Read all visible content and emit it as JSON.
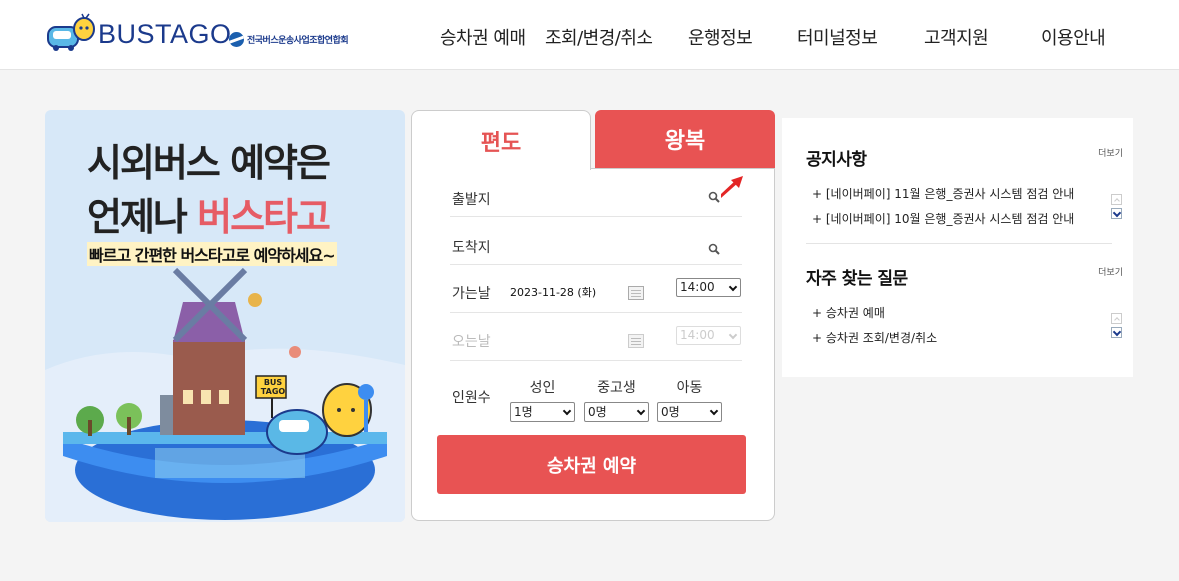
{
  "header": {
    "logo_text": "BUSTAGO",
    "association_text": "전국버스운송사업조합연합회",
    "nav": [
      {
        "label": "승차권 예매"
      },
      {
        "label": "조회/변경/취소"
      },
      {
        "label": "운행정보"
      },
      {
        "label": "터미널정보"
      },
      {
        "label": "고객지원"
      },
      {
        "label": "이용안내"
      }
    ]
  },
  "promo": {
    "line1": "시외버스 예약은",
    "line2_prefix": "언제나 ",
    "line2_highlight": "버스타고",
    "subtitle": "빠르고 간편한 버스타고로 예약하세요~",
    "bus_sign": [
      "BUS",
      "TAGO"
    ]
  },
  "booking": {
    "tabs": {
      "oneway": "편도",
      "roundtrip": "왕복"
    },
    "departure_label": "출발지",
    "arrival_label": "도착지",
    "go_date_label": "가는날",
    "go_date_value": "2023-11-28 (화)",
    "go_time_value": "14:00",
    "return_date_label": "오는날",
    "return_time_value": "14:00",
    "passengers_label": "인원수",
    "passenger_types": [
      {
        "label": "성인",
        "value": "1명"
      },
      {
        "label": "중고생",
        "value": "0명"
      },
      {
        "label": "아동",
        "value": "0명"
      }
    ],
    "submit_label": "승차권 예약"
  },
  "notices": {
    "title": "공지사항",
    "more_label": "더보기",
    "items": [
      "+ [네이버페이] 11월 은행_증권사 시스템 점검 안내",
      "+ [네이버페이] 10월 은행_증권사 시스템 점검 안내"
    ]
  },
  "faq": {
    "title": "자주 찾는 질문",
    "more_label": "더보기",
    "items": [
      "+ 승차권 예매",
      "+ 승차권 조회/변경/취소"
    ]
  },
  "colors": {
    "accent_red": "#e85353",
    "brand_navy": "#1b3a8c",
    "highlight_pink": "#e65c65"
  }
}
